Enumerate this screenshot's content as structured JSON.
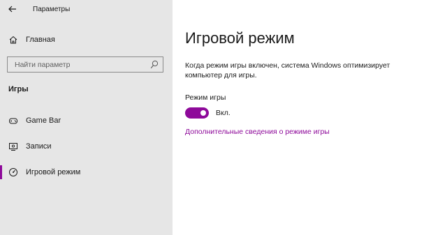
{
  "window": {
    "title": "Параметры",
    "back_icon": "arrow-left-icon"
  },
  "sidebar": {
    "home": {
      "label": "Главная",
      "icon": "home-icon"
    },
    "search": {
      "placeholder": "Найти параметр",
      "icon": "search-icon"
    },
    "section_heading": "Игры",
    "items": [
      {
        "label": "Game Bar",
        "icon": "game-controller-icon",
        "selected": false
      },
      {
        "label": "Записи",
        "icon": "capture-icon",
        "selected": false
      },
      {
        "label": "Игровой режим",
        "icon": "game-mode-icon",
        "selected": true
      }
    ]
  },
  "main": {
    "title": "Игровой режим",
    "description": "Когда режим игры включен, система Windows оптимизирует компьютер для игры.",
    "setting": {
      "label": "Режим игры",
      "state_label": "Вкл.",
      "on": true
    },
    "link": "Дополнительные сведения о режиме игры"
  },
  "colors": {
    "accent": "#8e0a9a",
    "sidebar_bg": "#e6e6e6",
    "main_bg": "#ffffff"
  }
}
